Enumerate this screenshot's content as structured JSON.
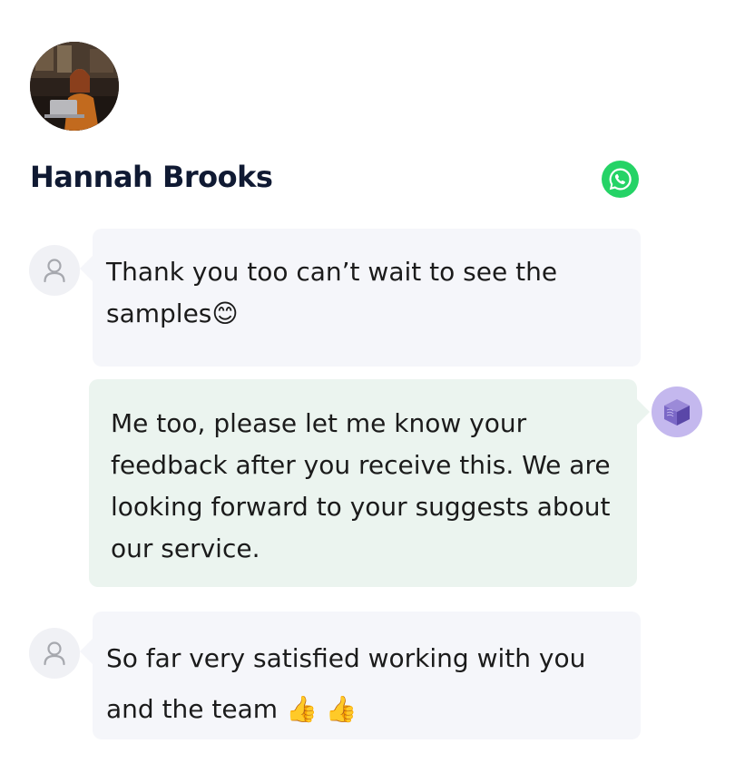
{
  "contact": {
    "name": "Hannah Brooks"
  },
  "messages": [
    {
      "text": "Thank you too can’t wait to see the samples",
      "emoji": "😊"
    },
    {
      "text": "Me too, please let me know your feedback after you receive this. We are looking forward to your suggests about our service."
    },
    {
      "text": "So far very satisfied working with you and the team",
      "emoji": "👍 👍"
    }
  ],
  "colors": {
    "whatsapp": "#25D366",
    "incoming_bubble": "#F5F6FA",
    "outgoing_bubble": "#EBF4EF",
    "name": "#101A33"
  }
}
